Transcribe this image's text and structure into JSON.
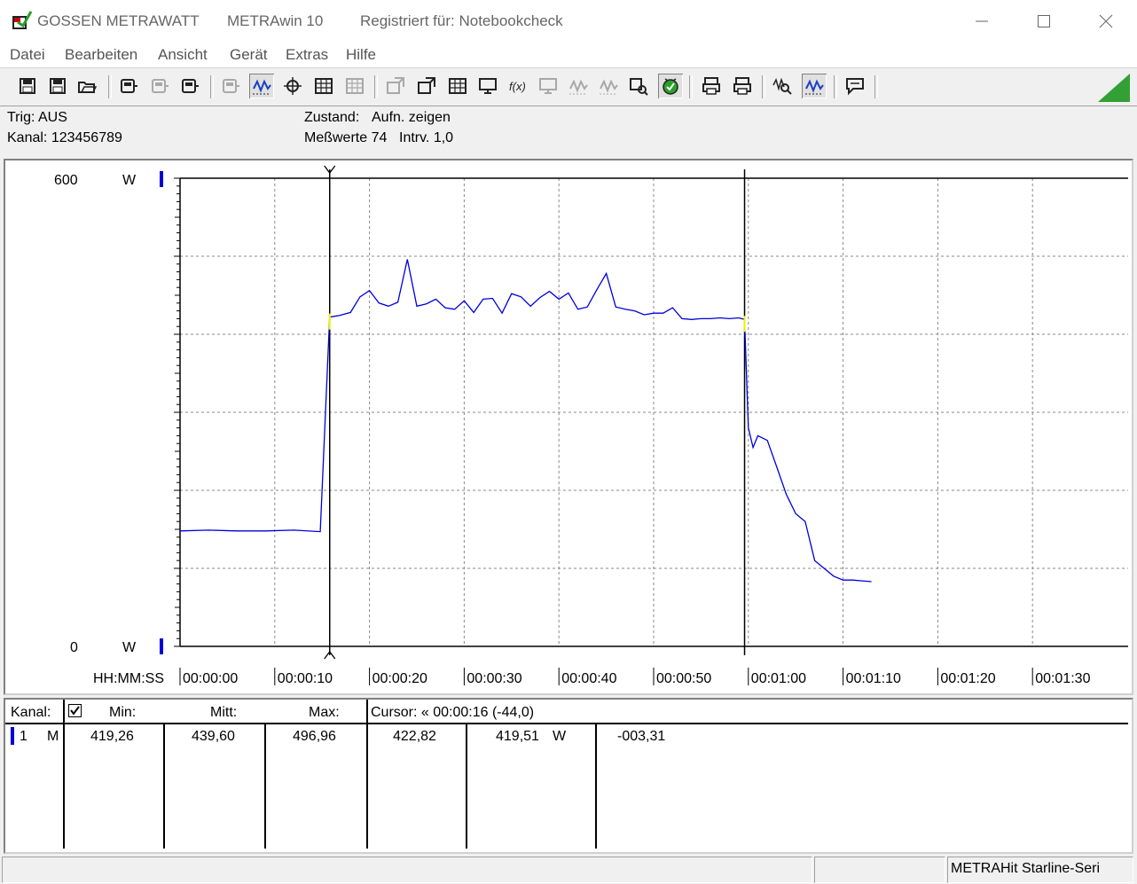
{
  "window": {
    "brand": "GOSSEN METRAWATT",
    "app": "METRAwin 10",
    "registered": "Registriert für: Notebookcheck",
    "controls": [
      "minimize-icon",
      "maximize-icon",
      "close-icon"
    ]
  },
  "menu": [
    "Datei",
    "Bearbeiten",
    "Ansicht",
    "Gerät",
    "Extras",
    "Hilfe"
  ],
  "toolbar": {
    "icons": [
      "save-icon",
      "save-as-icon",
      "open-folder-icon",
      "device-read-icon",
      "device-disabled-icon",
      "device-send-icon",
      "keypad-disabled-icon",
      "wave-display-icon",
      "crosshair-icon",
      "table-view-icon",
      "list-view-disabled-icon",
      "export-disabled-icon",
      "print-preview-icon",
      "data-grid-icon",
      "monitor-icon",
      "function-icon",
      "meter-disabled-icon",
      "signal-disabled-icon",
      "waveform-disabled-icon",
      "search-device-icon",
      "trigger-icon",
      "printer-icon",
      "printer-color-icon",
      "zoom-in-icon",
      "zoom-wave-icon",
      "comment-icon"
    ],
    "pressed": [
      "wave-display-icon",
      "trigger-icon",
      "zoom-wave-icon"
    ]
  },
  "info": {
    "trig": "Trig: AUS",
    "kanal": "Kanal: 123456789",
    "zustand_label": "Zustand:",
    "zustand_value": "Aufn. zeigen",
    "messwerte": "Meßwerte 74",
    "intervall": "Intrv. 1,0"
  },
  "chart_data": {
    "type": "line",
    "y_top_label": "600",
    "y_bottom_label": "0",
    "y_unit": "W",
    "ylim": [
      0,
      600
    ],
    "x_label": "HH:MM:SS",
    "x_ticks": [
      "00:00:00",
      "00:00:10",
      "00:00:20",
      "00:00:30",
      "00:00:40",
      "00:00:50",
      "00:01:00",
      "00:01:10",
      "00:01:20",
      "00:01:30"
    ],
    "xlim": [
      0,
      95
    ],
    "grid": true,
    "line_color": "#0000dd",
    "cursor_x": [
      15.8,
      59.6
    ],
    "series": [
      {
        "x": [
          0,
          3,
          6,
          9,
          12,
          14.8,
          15.8,
          16.8,
          18,
          19,
          20,
          21,
          22,
          23,
          24,
          25,
          26,
          27,
          28,
          29,
          30,
          31,
          32,
          33,
          34,
          35,
          36,
          37,
          38,
          39,
          40,
          41,
          42,
          43,
          44,
          45,
          46,
          47,
          48,
          49,
          50,
          51,
          52,
          53,
          54,
          55,
          56,
          57,
          58,
          59,
          59.6,
          60,
          60.5,
          61,
          62,
          63,
          64,
          65,
          66,
          67,
          68,
          69,
          70,
          71,
          72,
          73
        ],
        "y": [
          148,
          149,
          148,
          148,
          149,
          147,
          422,
          424,
          428,
          448,
          456,
          440,
          436,
          441,
          496,
          436,
          439,
          445,
          434,
          432,
          443,
          428,
          445,
          446,
          427,
          452,
          448,
          436,
          447,
          455,
          445,
          453,
          432,
          435,
          457,
          478,
          435,
          432,
          430,
          425,
          427,
          427,
          434,
          420,
          419,
          420,
          420,
          421,
          420,
          421,
          419,
          280,
          255,
          270,
          264,
          230,
          195,
          170,
          160,
          110,
          100,
          90,
          85,
          85,
          84,
          83
        ]
      }
    ]
  },
  "table": {
    "headers": {
      "kanal": "Kanal:",
      "min": "Min:",
      "mitt": "Mitt:",
      "max": "Max:",
      "cursor": "Cursor: « 00:00:16 (-44,0)"
    },
    "row": {
      "index": "1",
      "mode": "M",
      "min": "419,26",
      "mitt": "439,60",
      "max": "496,96",
      "cursor1": "422,82",
      "cursor2": "419,51",
      "unit": "W",
      "diff": "-003,31"
    }
  },
  "status": {
    "device": "METRAHit Starline-Seri"
  }
}
